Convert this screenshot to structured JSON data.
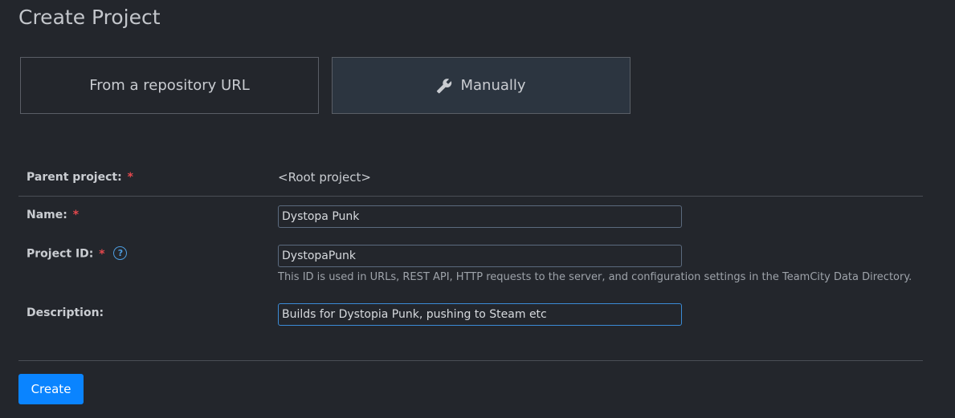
{
  "page": {
    "title": "Create Project"
  },
  "mode_tabs": {
    "repo_label": "From a repository URL",
    "manual_label": "Manually",
    "manual_icon": "wrench-icon"
  },
  "form": {
    "parent_project": {
      "label": "Parent project:",
      "required_mark": "*",
      "value": "<Root project>"
    },
    "name": {
      "label": "Name:",
      "required_mark": "*",
      "value": "Dystopa Punk"
    },
    "project_id": {
      "label": "Project ID:",
      "required_mark": "*",
      "help_icon": "question-circle-icon",
      "help_glyph": "?",
      "value": "DystopaPunk",
      "hint": "This ID is used in URLs, REST API, HTTP requests to the server, and configuration settings in the TeamCity Data Directory."
    },
    "description": {
      "label": "Description:",
      "value": "Builds for Dystopia Punk, pushing to Steam etc"
    }
  },
  "actions": {
    "create_label": "Create"
  },
  "colors": {
    "background": "#23262c",
    "primary_button": "#0a84ff",
    "required": "#e5484d",
    "help_icon": "#4d9de0",
    "selected_tab": "#2c3540"
  }
}
